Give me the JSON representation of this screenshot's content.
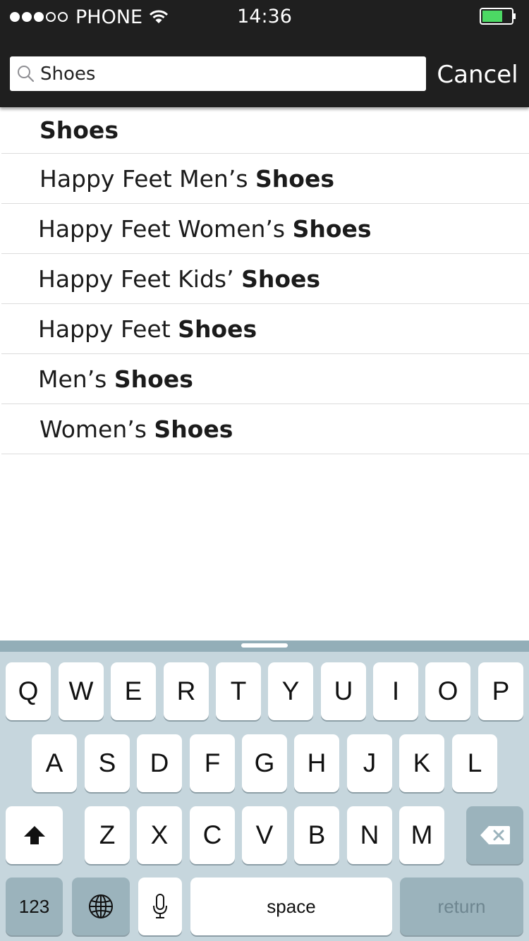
{
  "status_bar": {
    "carrier": "PHONE",
    "time": "14:36",
    "battery_color": "#4cd964"
  },
  "search": {
    "value": "Shoes",
    "cancel_label": "Cancel"
  },
  "suggestions": [
    {
      "prefix": "",
      "match": "Shoes"
    },
    {
      "prefix": "Happy Feet Men’s ",
      "match": "Shoes"
    },
    {
      "prefix": "Happy Feet Women’s ",
      "match": "Shoes"
    },
    {
      "prefix": "Happy Feet Kids’ ",
      "match": "Shoes"
    },
    {
      "prefix": "Happy Feet ",
      "match": "Shoes"
    },
    {
      "prefix": "Men’s ",
      "match": "Shoes"
    },
    {
      "prefix": "Women’s ",
      "match": "Shoes"
    }
  ],
  "keyboard": {
    "row1": [
      "Q",
      "W",
      "E",
      "R",
      "T",
      "Y",
      "U",
      "I",
      "O",
      "P"
    ],
    "row2": [
      "A",
      "S",
      "D",
      "F",
      "G",
      "H",
      "J",
      "K",
      "L"
    ],
    "row3": [
      "Z",
      "X",
      "C",
      "V",
      "B",
      "N",
      "M"
    ],
    "numbers_label": "123",
    "space_label": "space",
    "return_label": "return"
  }
}
